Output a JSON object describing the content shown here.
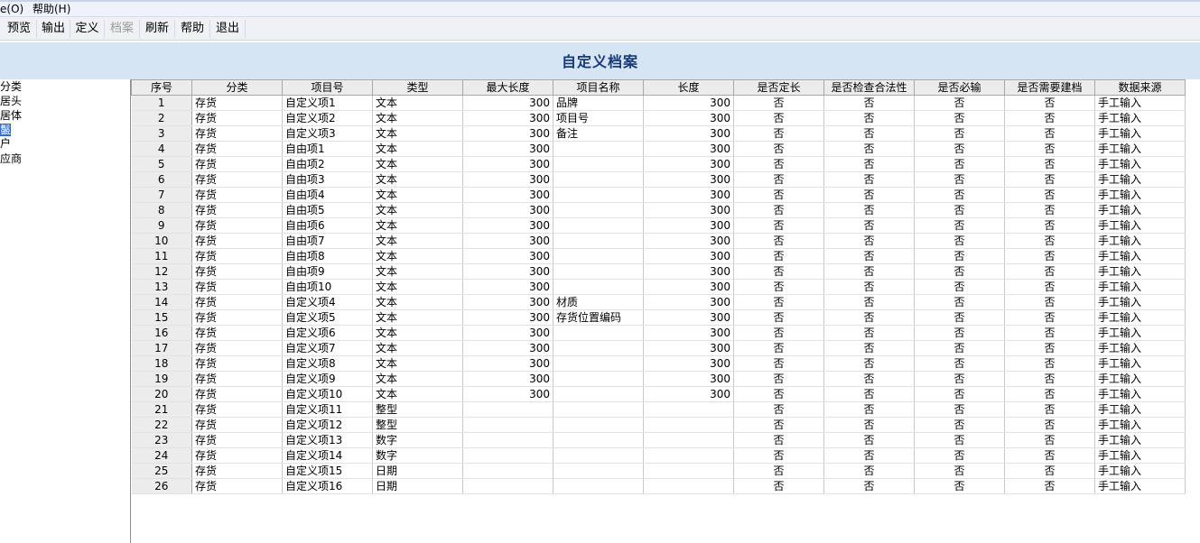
{
  "menu": {
    "items": [
      "e(O)",
      "帮助(H)"
    ]
  },
  "toolbar": {
    "buttons": [
      {
        "label": "预览",
        "enabled": true
      },
      {
        "label": "输出",
        "enabled": true
      },
      {
        "label": "定义",
        "enabled": true
      },
      {
        "label": "档案",
        "enabled": false
      },
      {
        "label": "刷新",
        "enabled": true
      },
      {
        "label": "帮助",
        "enabled": true
      },
      {
        "label": "退出",
        "enabled": true
      }
    ]
  },
  "title": "自定义档案",
  "tree": {
    "items": [
      {
        "label": "分类",
        "selected": false
      },
      {
        "label": "居头",
        "selected": false
      },
      {
        "label": "居体",
        "selected": false
      },
      {
        "label": "鬣",
        "selected": true
      },
      {
        "label": "户",
        "selected": false
      },
      {
        "label": "应商",
        "selected": false
      }
    ]
  },
  "table": {
    "columns": [
      "序号",
      "分类",
      "项目号",
      "类型",
      "最大长度",
      "项目名称",
      "长度",
      "是否定长",
      "是否检查合法性",
      "是否必输",
      "是否需要建档",
      "数据来源"
    ],
    "rows": [
      [
        "1",
        "存货",
        "自定义项1",
        "文本",
        "300",
        "品牌",
        "300",
        "否",
        "否",
        "否",
        "否",
        "手工输入"
      ],
      [
        "2",
        "存货",
        "自定义项2",
        "文本",
        "300",
        "项目号",
        "300",
        "否",
        "否",
        "否",
        "否",
        "手工输入"
      ],
      [
        "3",
        "存货",
        "自定义项3",
        "文本",
        "300",
        "备注",
        "300",
        "否",
        "否",
        "否",
        "否",
        "手工输入"
      ],
      [
        "4",
        "存货",
        "自由项1",
        "文本",
        "300",
        "",
        "300",
        "否",
        "否",
        "否",
        "否",
        "手工输入"
      ],
      [
        "5",
        "存货",
        "自由项2",
        "文本",
        "300",
        "",
        "300",
        "否",
        "否",
        "否",
        "否",
        "手工输入"
      ],
      [
        "6",
        "存货",
        "自由项3",
        "文本",
        "300",
        "",
        "300",
        "否",
        "否",
        "否",
        "否",
        "手工输入"
      ],
      [
        "7",
        "存货",
        "自由项4",
        "文本",
        "300",
        "",
        "300",
        "否",
        "否",
        "否",
        "否",
        "手工输入"
      ],
      [
        "8",
        "存货",
        "自由项5",
        "文本",
        "300",
        "",
        "300",
        "否",
        "否",
        "否",
        "否",
        "手工输入"
      ],
      [
        "9",
        "存货",
        "自由项6",
        "文本",
        "300",
        "",
        "300",
        "否",
        "否",
        "否",
        "否",
        "手工输入"
      ],
      [
        "10",
        "存货",
        "自由项7",
        "文本",
        "300",
        "",
        "300",
        "否",
        "否",
        "否",
        "否",
        "手工输入"
      ],
      [
        "11",
        "存货",
        "自由项8",
        "文本",
        "300",
        "",
        "300",
        "否",
        "否",
        "否",
        "否",
        "手工输入"
      ],
      [
        "12",
        "存货",
        "自由项9",
        "文本",
        "300",
        "",
        "300",
        "否",
        "否",
        "否",
        "否",
        "手工输入"
      ],
      [
        "13",
        "存货",
        "自由项10",
        "文本",
        "300",
        "",
        "300",
        "否",
        "否",
        "否",
        "否",
        "手工输入"
      ],
      [
        "14",
        "存货",
        "自定义项4",
        "文本",
        "300",
        "材质",
        "300",
        "否",
        "否",
        "否",
        "否",
        "手工输入"
      ],
      [
        "15",
        "存货",
        "自定义项5",
        "文本",
        "300",
        "存货位置编码",
        "300",
        "否",
        "否",
        "否",
        "否",
        "手工输入"
      ],
      [
        "16",
        "存货",
        "自定义项6",
        "文本",
        "300",
        "",
        "300",
        "否",
        "否",
        "否",
        "否",
        "手工输入"
      ],
      [
        "17",
        "存货",
        "自定义项7",
        "文本",
        "300",
        "",
        "300",
        "否",
        "否",
        "否",
        "否",
        "手工输入"
      ],
      [
        "18",
        "存货",
        "自定义项8",
        "文本",
        "300",
        "",
        "300",
        "否",
        "否",
        "否",
        "否",
        "手工输入"
      ],
      [
        "19",
        "存货",
        "自定义项9",
        "文本",
        "300",
        "",
        "300",
        "否",
        "否",
        "否",
        "否",
        "手工输入"
      ],
      [
        "20",
        "存货",
        "自定义项10",
        "文本",
        "300",
        "",
        "300",
        "否",
        "否",
        "否",
        "否",
        "手工输入"
      ],
      [
        "21",
        "存货",
        "自定义项11",
        "整型",
        "",
        "",
        "",
        "否",
        "否",
        "否",
        "否",
        "手工输入"
      ],
      [
        "22",
        "存货",
        "自定义项12",
        "整型",
        "",
        "",
        "",
        "否",
        "否",
        "否",
        "否",
        "手工输入"
      ],
      [
        "23",
        "存货",
        "自定义项13",
        "数字",
        "",
        "",
        "",
        "否",
        "否",
        "否",
        "否",
        "手工输入"
      ],
      [
        "24",
        "存货",
        "自定义项14",
        "数字",
        "",
        "",
        "",
        "否",
        "否",
        "否",
        "否",
        "手工输入"
      ],
      [
        "25",
        "存货",
        "自定义项15",
        "日期",
        "",
        "",
        "",
        "否",
        "否",
        "否",
        "否",
        "手工输入"
      ],
      [
        "26",
        "存货",
        "自定义项16",
        "日期",
        "",
        "",
        "",
        "否",
        "否",
        "否",
        "否",
        "手工输入"
      ]
    ]
  }
}
